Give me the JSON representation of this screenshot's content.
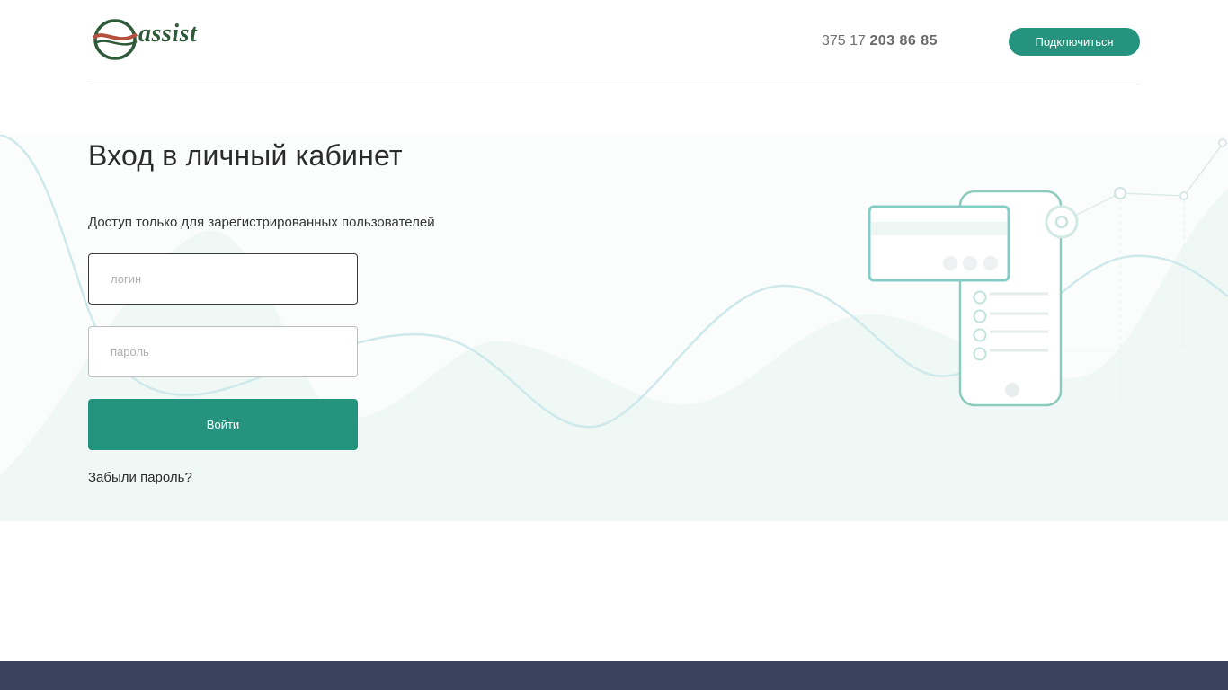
{
  "header": {
    "logo_text": "assist",
    "phone_prefix": "375 17 ",
    "phone_main": "203 86 85",
    "connect_label": "Подключиться"
  },
  "main": {
    "title": "Вход в личный кабинет",
    "subtitle": "Доступ только для зарегистрированных пользователей",
    "login_placeholder": "логин",
    "password_placeholder": "пароль",
    "submit_label": "Войти",
    "forgot_label": "Забыли пароль?"
  },
  "colors": {
    "accent": "#26937e",
    "footer": "#3b425c",
    "logo_green": "#2f5a3a",
    "logo_red": "#b5503f"
  },
  "icons": [
    "assist-logo-icon",
    "payment-phone-illustration"
  ]
}
